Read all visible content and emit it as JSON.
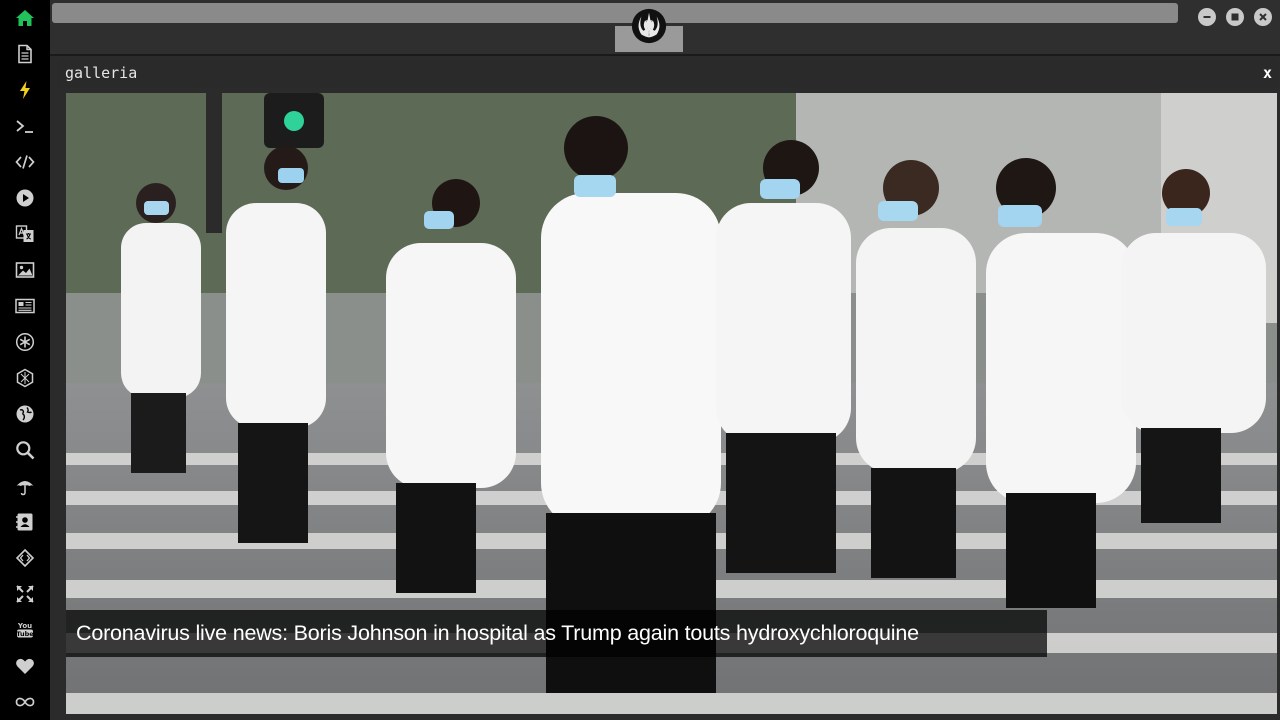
{
  "sidebar": {
    "items": [
      {
        "icon": "home-icon",
        "color": "#22c25a"
      },
      {
        "icon": "document-icon",
        "color": "#cfcfcf"
      },
      {
        "icon": "lightning-icon",
        "color": "#f0d020"
      },
      {
        "icon": "terminal-icon",
        "color": "#cfcfcf"
      },
      {
        "icon": "code-icon",
        "color": "#cfcfcf"
      },
      {
        "icon": "play-icon",
        "color": "#cfcfcf"
      },
      {
        "icon": "translate-icon",
        "color": "#cfcfcf"
      },
      {
        "icon": "image-icon",
        "color": "#cfcfcf"
      },
      {
        "icon": "newspaper-icon",
        "color": "#cfcfcf"
      },
      {
        "icon": "asterisk-icon",
        "color": "#cfcfcf"
      },
      {
        "icon": "hexagon-icon",
        "color": "#cfcfcf"
      },
      {
        "icon": "globe-icon",
        "color": "#cfcfcf"
      },
      {
        "icon": "search-icon",
        "color": "#cfcfcf"
      },
      {
        "icon": "umbrella-icon",
        "color": "#cfcfcf"
      },
      {
        "icon": "contact-card-icon",
        "color": "#cfcfcf"
      },
      {
        "icon": "diamond-code-icon",
        "color": "#cfcfcf"
      },
      {
        "icon": "expand-arrows-icon",
        "color": "#cfcfcf"
      },
      {
        "icon": "youtube-icon",
        "color": "#cfcfcf"
      },
      {
        "icon": "heart-icon",
        "color": "#cfcfcf"
      },
      {
        "icon": "infinity-icon",
        "color": "#cfcfcf"
      }
    ]
  },
  "window": {
    "logo_icon": "rebel-alliance-icon",
    "controls": [
      "minimize-icon",
      "maximize-icon",
      "close-icon"
    ]
  },
  "panel": {
    "title": "galleria",
    "close_label": "x"
  },
  "gallery": {
    "caption": "Coronavirus live news: Boris Johnson in hospital as Trump again touts hydroxychloroquine"
  }
}
